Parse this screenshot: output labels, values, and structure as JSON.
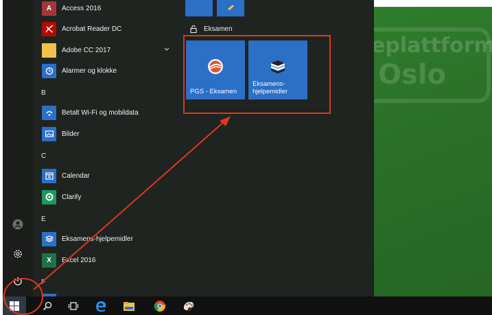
{
  "apps": [
    {
      "label": "Access 2016",
      "icon": "access-icon",
      "color": "#a4373a"
    },
    {
      "label": "Acrobat Reader DC",
      "icon": "acrobat-icon",
      "color": "#b30b00"
    },
    {
      "label": "Adobe CC 2017",
      "icon": "folder-icon",
      "color": "#f0c24b"
    },
    {
      "label": "Alarmer og klokke",
      "icon": "alarm-icon",
      "color": "#2b6fc7"
    },
    {
      "label": "Betalt Wi-Fi og mobildata",
      "icon": "wifi-icon",
      "color": "#2b6fc7"
    },
    {
      "label": "Bilder",
      "icon": "photos-icon",
      "color": "#2b6fc7"
    },
    {
      "label": "Calendar",
      "icon": "calendar-icon",
      "color": "#2b6fc7"
    },
    {
      "label": "Clarify",
      "icon": "clarify-icon",
      "color": "#1e9a5e"
    },
    {
      "label": "Eksamens-hjelpemidler",
      "icon": "books-icon",
      "color": "#2b6fc7"
    },
    {
      "label": "Excel 2016",
      "icon": "excel-icon",
      "color": "#1f7244"
    }
  ],
  "headers": {
    "b": "B",
    "c": "C",
    "e": "E",
    "f": "F"
  },
  "tiles": {
    "group_title": "Eksamen",
    "pgs": "PGS - Eksamen",
    "hjelpemidler": "Eksamens-\nhjelpemidler"
  },
  "wallpaper": {
    "line1": "eplattform",
    "line2": "Oslo"
  },
  "colors": {
    "accent": "#2b6fc7",
    "highlight": "#e0361f",
    "desktop": "#2a6f27"
  }
}
